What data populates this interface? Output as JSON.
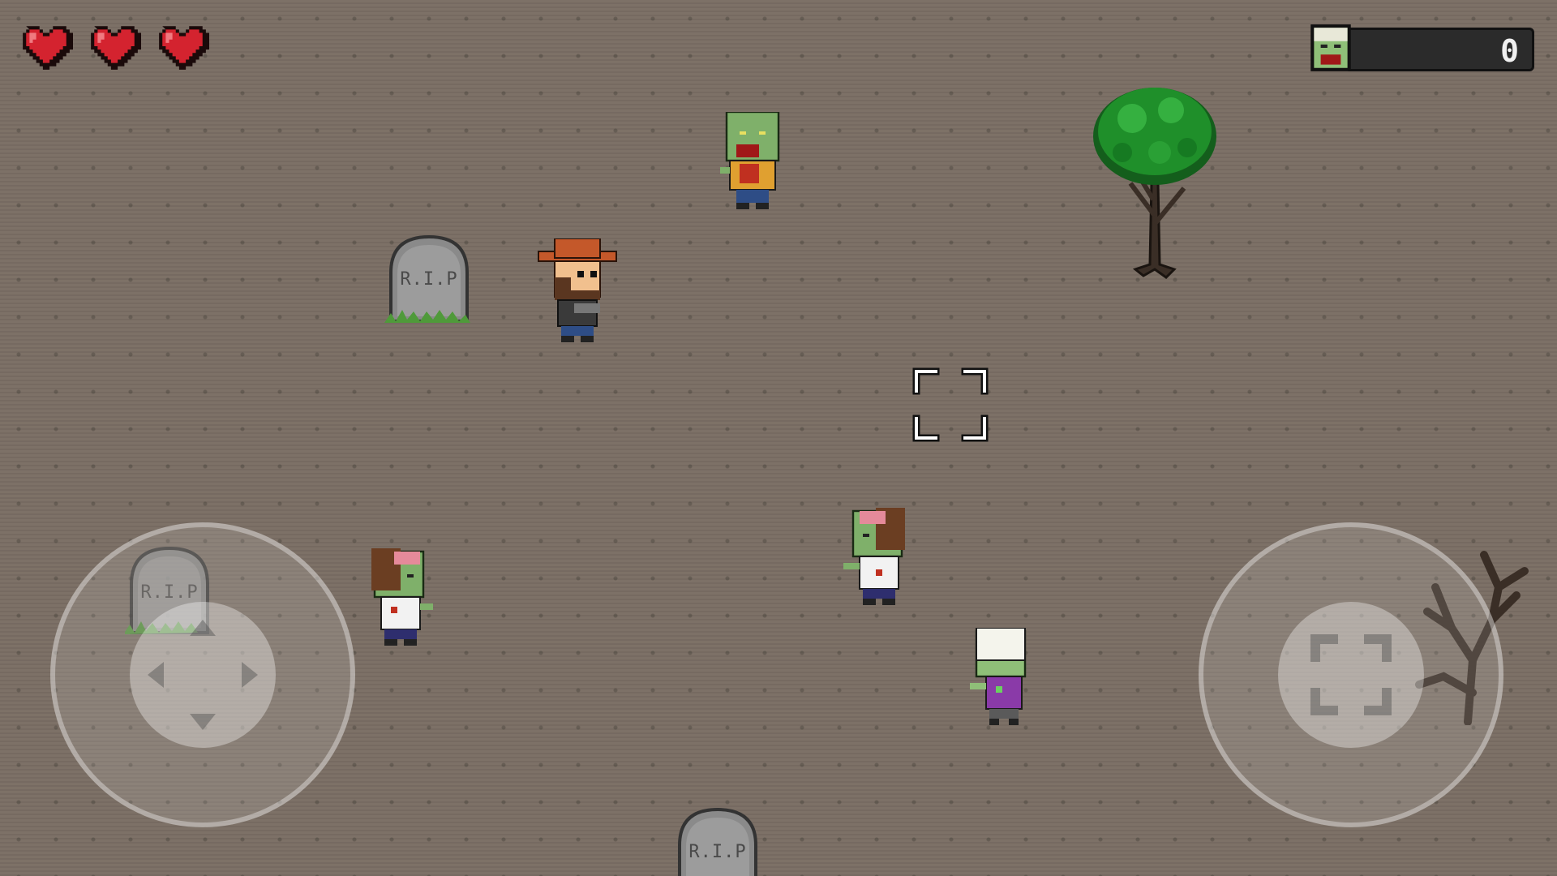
{
  "hud": {
    "lives": 3,
    "hearts": [
      {
        "icon": "heart-icon",
        "state": "full"
      },
      {
        "icon": "heart-icon",
        "state": "full"
      },
      {
        "icon": "heart-icon",
        "state": "full"
      }
    ],
    "kill_counter": {
      "icon": "zombie-head-icon",
      "value": "0"
    }
  },
  "tombstones": [
    {
      "label": "R.I.P"
    },
    {
      "label": "R.I.P"
    },
    {
      "label": "R.I.P"
    }
  ],
  "controls": {
    "move_joystick": {
      "icon": "dpad-arrows-icon"
    },
    "fire_joystick": {
      "icon": "crosshair-icon"
    }
  },
  "colors": {
    "ground": "#7d7167",
    "heart": "#d4232f",
    "zombie_skin": "#7fb06a",
    "tree_leaves": "#1f8f2a",
    "hat": "#c4582a"
  }
}
